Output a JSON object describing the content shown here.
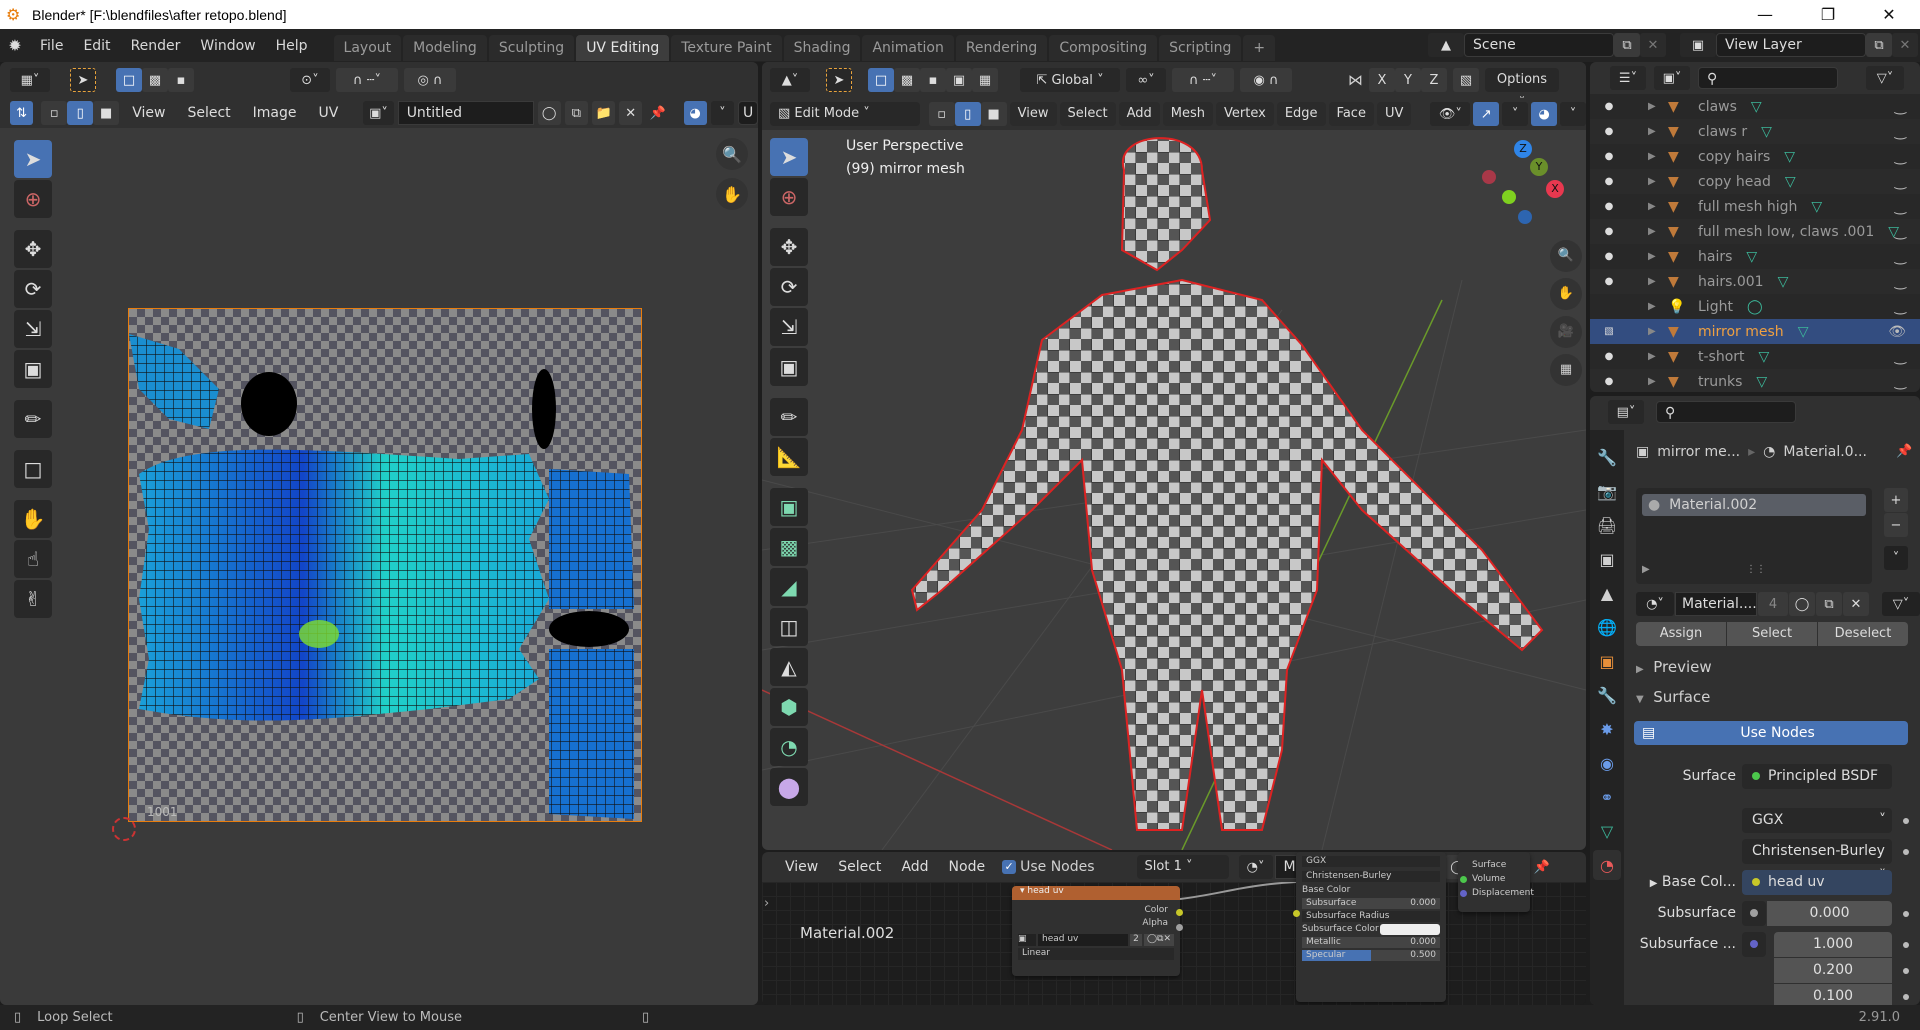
{
  "window": {
    "title": "Blender* [F:\\blendfiles\\after retopo.blend]",
    "controls": [
      "minimize",
      "maximize",
      "close"
    ]
  },
  "menubar": {
    "items": [
      "File",
      "Edit",
      "Render",
      "Window",
      "Help"
    ],
    "workspaces": [
      "Layout",
      "Modeling",
      "Sculpting",
      "UV Editing",
      "Texture Paint",
      "Shading",
      "Animation",
      "Rendering",
      "Compositing",
      "Scripting"
    ],
    "active_workspace": "UV Editing",
    "add_workspace": "+",
    "scene": "Scene",
    "view_layer": "View Layer"
  },
  "uv_editor": {
    "menus": [
      "View",
      "Select",
      "Image",
      "UV"
    ],
    "image_name": "Untitled",
    "truncated_field": "U",
    "tile_label": "1001",
    "tools": [
      "select-box",
      "cursor",
      "move",
      "rotate",
      "scale",
      "transform",
      "annotate",
      "rip",
      "grab",
      "relax",
      "pinch"
    ]
  },
  "viewport": {
    "orientation": "Global",
    "options_label": "Options",
    "mode": "Edit Mode",
    "menus": [
      "View",
      "Select",
      "Add",
      "Mesh",
      "Vertex",
      "Edge",
      "Face",
      "UV"
    ],
    "axis_buttons": [
      "X",
      "Y",
      "Z"
    ],
    "overlay_text_1": "User Perspective",
    "overlay_text_2": "(99) mirror mesh",
    "gizmo_axes": [
      "Z",
      "Y",
      "X"
    ],
    "tools": [
      "select-box",
      "cursor",
      "move",
      "rotate",
      "scale",
      "transform",
      "annotate",
      "measure",
      "extrude",
      "inset",
      "bevel",
      "loop-cut",
      "knife",
      "poly-build",
      "spin",
      "smooth"
    ]
  },
  "node_editor": {
    "menus": [
      "View",
      "Select",
      "Add",
      "Node"
    ],
    "use_nodes_label": "Use Nodes",
    "use_nodes_checked": true,
    "slot": "Slot 1",
    "material": "Material.002",
    "users": "4",
    "material_label": "Material.002",
    "image_node": {
      "title": "head uv",
      "outputs": [
        "Color",
        "Alpha"
      ],
      "image": "head uv",
      "image_users": "2",
      "interpolation": "Linear"
    },
    "bsdf_node": {
      "distribution": "GGX",
      "subsurface_method": "Christensen-Burley",
      "inputs": [
        {
          "name": "Base Color"
        },
        {
          "name": "Subsurface",
          "value": "0.000"
        },
        {
          "name": "Subsurface Radius"
        },
        {
          "name": "Subsurface Color"
        },
        {
          "name": "Metallic",
          "value": "0.000"
        },
        {
          "name": "Specular",
          "value": "0.500",
          "fill": 0.5
        }
      ]
    },
    "output_node": {
      "inputs": [
        "Surface",
        "Volume",
        "Displacement"
      ]
    }
  },
  "outliner": {
    "items": [
      {
        "name": "claws",
        "type": "mesh"
      },
      {
        "name": "claws r",
        "type": "mesh"
      },
      {
        "name": "copy hairs",
        "type": "mesh"
      },
      {
        "name": "copy head",
        "type": "mesh"
      },
      {
        "name": "full mesh high",
        "type": "mesh"
      },
      {
        "name": "full mesh low, claws .001",
        "type": "mesh"
      },
      {
        "name": "hairs",
        "type": "mesh"
      },
      {
        "name": "hairs.001",
        "type": "mesh"
      },
      {
        "name": "Light",
        "type": "light"
      },
      {
        "name": "mirror mesh",
        "type": "mesh",
        "selected": true
      },
      {
        "name": "t-short",
        "type": "mesh"
      },
      {
        "name": "trunks",
        "type": "mesh"
      }
    ]
  },
  "properties": {
    "breadcrumb_object": "mirror me...",
    "breadcrumb_material": "Material.0...",
    "slots": [
      "Material.002"
    ],
    "material_field": "Material....",
    "material_users": "4",
    "assign": "Assign",
    "select": "Select",
    "deselect": "Deselect",
    "panel_preview": "Preview",
    "panel_surface": "Surface",
    "use_nodes": "Use Nodes",
    "surface_label": "Surface",
    "surface_value": "Principled BSDF",
    "distribution": "GGX",
    "subsurface_method": "Christensen-Burley",
    "base_color_label": "Base Col...",
    "base_color_value": "head uv",
    "subsurface_label": "Subsurface",
    "subsurface_value": "0.000",
    "subsurface_radius_label": "Subsurface ...",
    "subsurface_radius": [
      "1.000",
      "0.200",
      "0.100"
    ]
  },
  "statusbar": {
    "left_action": "Loop Select",
    "middle_action": "Center View to Mouse",
    "version": "2.91.0"
  },
  "colors": {
    "accent": "#4772b3",
    "selection_orange": "#e87d0d",
    "outliner_selected": "#334d80",
    "mesh_icon": "#c07a3a",
    "data_icon": "#3cb89a",
    "seam_red": "#e02020",
    "axis_x": "#e8384f",
    "axis_y": "#6a8f2a",
    "axis_z": "#2f85e8",
    "node_header_image": "#b06030"
  }
}
